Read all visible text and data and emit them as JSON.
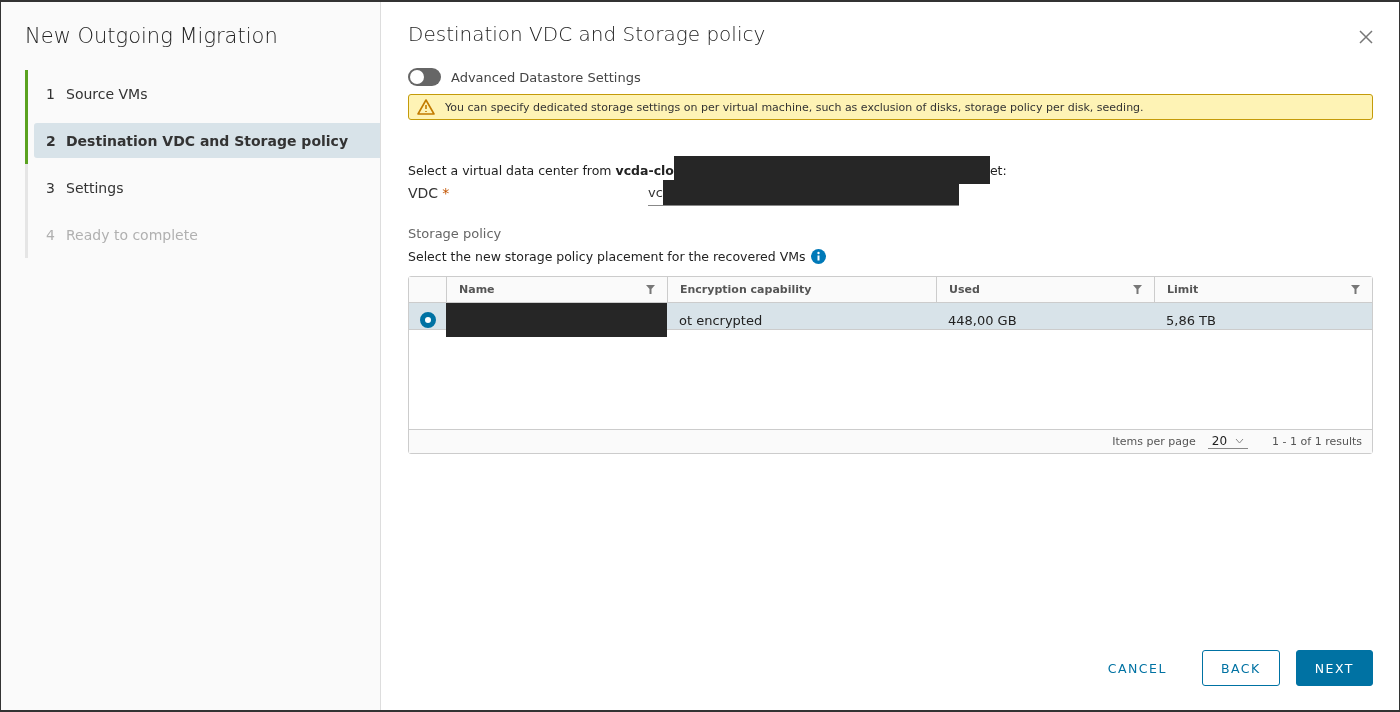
{
  "wizard": {
    "title": "New Outgoing Migration",
    "steps": [
      {
        "number": "1",
        "label": "Source VMs",
        "done": true,
        "selected": false,
        "disabled": false
      },
      {
        "number": "2",
        "label": "Destination VDC and Storage policy",
        "done": true,
        "selected": true,
        "disabled": false
      },
      {
        "number": "3",
        "label": "Settings",
        "done": false,
        "selected": false,
        "disabled": false
      },
      {
        "number": "4",
        "label": "Ready to complete",
        "done": false,
        "selected": false,
        "disabled": true
      }
    ]
  },
  "page": {
    "title": "Destination VDC and Storage policy",
    "toggle": {
      "label": "Advanced Datastore Settings",
      "on": false
    },
    "alert": {
      "text": "You can specify dedicated storage settings on per virtual machine, such as exclusion of disks, storage policy per disk, seeding."
    },
    "vdc_prompt": {
      "before": "Select a virtual data center from **vcda-clo**",
      "after": "et:"
    },
    "vdc_field": {
      "label": "VDC",
      "required_mark": "*",
      "value": "vc"
    },
    "storage_heading": "Storage policy",
    "storage_hint": "Select the new storage policy placement for the recovered VMs",
    "table": {
      "columns": [
        {
          "label": "Name",
          "filter": true
        },
        {
          "label": "Encryption capability",
          "filter": false
        },
        {
          "label": "Used",
          "filter": true
        },
        {
          "label": "Limit",
          "filter": true
        }
      ],
      "rows": [
        {
          "selected": true,
          "cells": [
            "",
            "ot encrypted",
            "448,00 GB",
            "5,86 TB"
          ]
        }
      ],
      "footer": {
        "items_label": "Items per page",
        "page_size": "20",
        "results": "1 - 1 of 1 results"
      }
    },
    "buttons": [
      {
        "label": "CANCEL",
        "kind": "flat"
      },
      {
        "label": "BACK",
        "kind": "outline"
      },
      {
        "label": "NEXT",
        "kind": "primary"
      }
    ]
  }
}
